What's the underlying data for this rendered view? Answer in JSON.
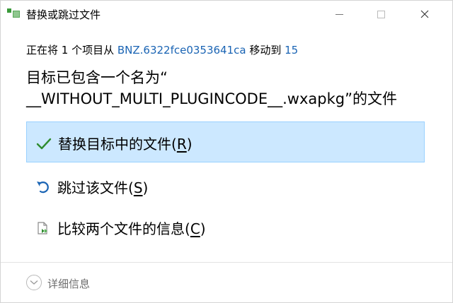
{
  "window": {
    "title": "替换或跳过文件",
    "icon": "file-move-app-icon"
  },
  "info": {
    "prefix": "正在将 1 个项目从 ",
    "source": "BNZ.6322fce0353641ca",
    "middle": " 移动到 ",
    "destination": "15"
  },
  "heading": {
    "line1": "目标已包含一个名为“",
    "line2": "__WITHOUT_MULTI_PLUGINCODE__.wxapkg”的文件"
  },
  "options": {
    "replace": {
      "label": "替换目标中的文件(",
      "key": "R",
      "suffix": ")",
      "icon": "checkmark-icon"
    },
    "skip": {
      "label": "跳过该文件(",
      "key": "S",
      "suffix": ")",
      "icon": "undo-arrow-icon"
    },
    "compare": {
      "label": "比较两个文件的信息(",
      "key": "C",
      "suffix": ")",
      "icon": "compare-files-icon"
    }
  },
  "details": {
    "label": "详细信息",
    "icon": "chevron-down-icon"
  },
  "colors": {
    "accent": "#1a64b4",
    "selected_bg": "#cce8ff",
    "selected_border": "#99d1ff",
    "check": "#2e8b2e"
  }
}
